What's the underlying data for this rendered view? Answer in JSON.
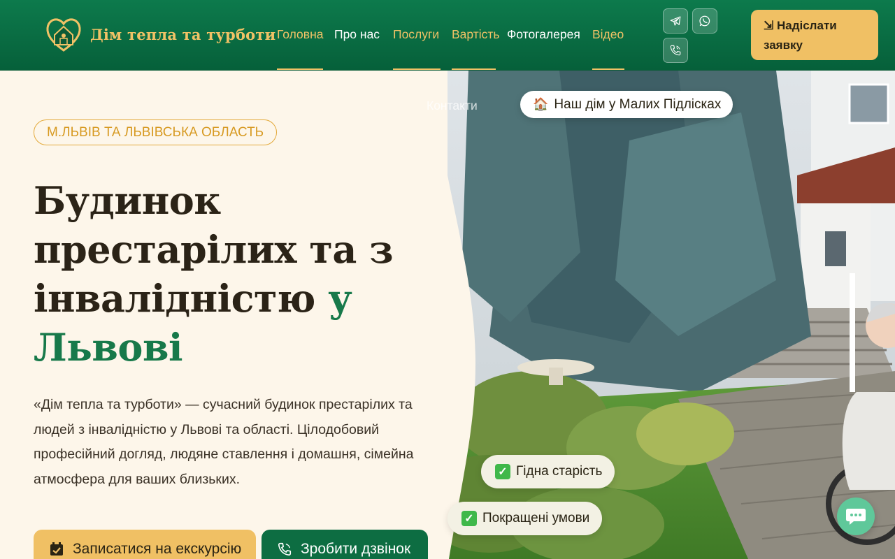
{
  "brand": {
    "name": "Дім тепла та турботи"
  },
  "nav": {
    "items": [
      {
        "label": "Головна"
      },
      {
        "label": "Про нас"
      },
      {
        "label": "Послуги"
      },
      {
        "label": "Вартість"
      },
      {
        "label": "Фотогалерея"
      },
      {
        "label": "Відео"
      },
      {
        "label": "Контакти"
      }
    ]
  },
  "header": {
    "cta_arrow": "⇲",
    "cta_label_line1": "Надіслати",
    "cta_label_line2": "заявку"
  },
  "hero": {
    "region_tag": "м.Львів та Львівська область",
    "title_part1": "Будинок престарілих та з інвалідністю",
    "title_highlight": "у Львові",
    "description": "«Дім тепла та турботи» — сучасний будинок престарілих та людей з інвалідністю у Львові та області. Цілодобовий професійний догляд, людяне ставлення і домашня, сімейна атмосфера для ваших близьких.",
    "btn_tour": "Записатися на екскурсію",
    "btn_call": "Зробити дзвінок"
  },
  "photo": {
    "location_pill_icon": "🏠",
    "location_pill": "Наш дім у Малих Підлісках",
    "badges": [
      {
        "label": "Гідна старість"
      },
      {
        "label": "Покращені умови"
      }
    ]
  },
  "colors": {
    "header_green": "#0d7a4c",
    "accent_gold": "#f0c064",
    "title_green": "#17794a",
    "cream": "#fdf6ea"
  },
  "icons": [
    "logo-heart-house-icon",
    "telegram-icon",
    "whatsapp-icon",
    "phone-icon",
    "calendar-check-icon",
    "chat-icon",
    "check-icon"
  ]
}
